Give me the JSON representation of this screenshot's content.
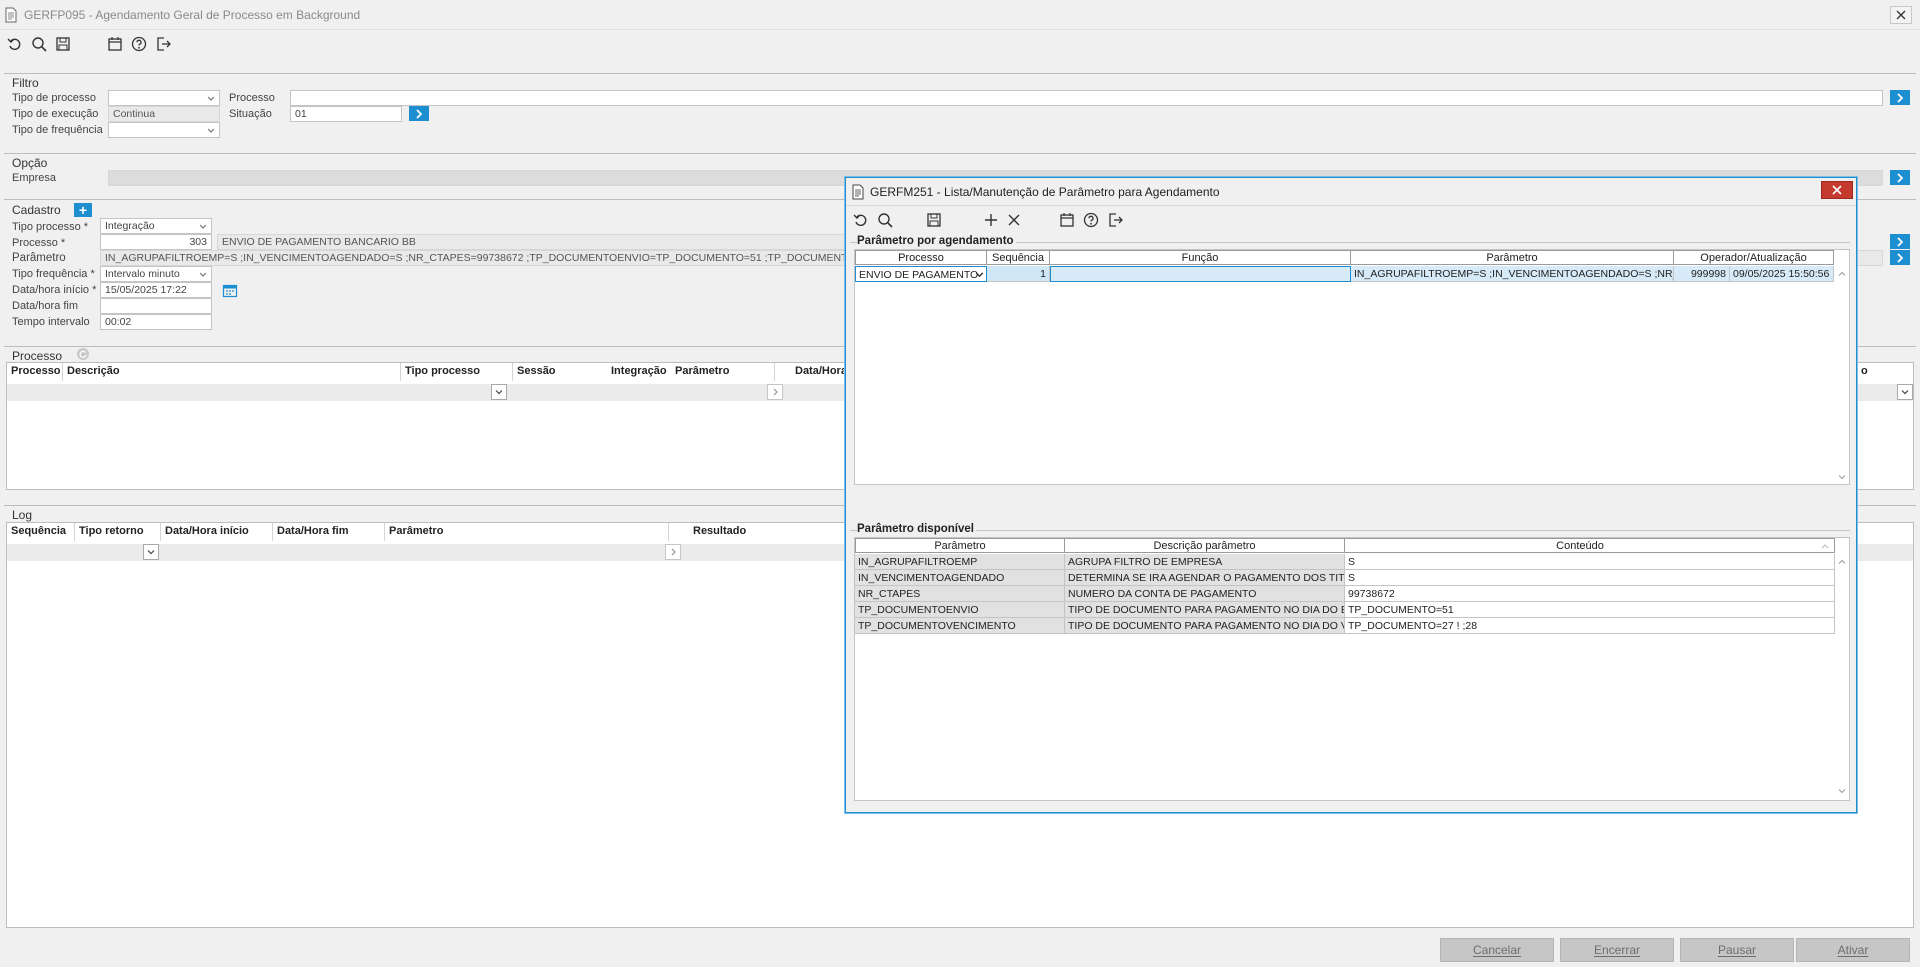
{
  "window": {
    "title": "GERFP095 - Agendamento Geral de Processo em Background"
  },
  "toolbar": {
    "icons": [
      "undo-icon",
      "search-icon",
      "save-icon",
      "calendar-icon",
      "help-icon",
      "exit-icon"
    ]
  },
  "filtro": {
    "title": "Filtro",
    "tipo_processo_label": "Tipo de processo",
    "tipo_execucao_label": "Tipo de execução",
    "tipo_execucao_value": "Continua",
    "tipo_frequencia_label": "Tipo de frequência",
    "processo_label": "Processo",
    "processo_value": "",
    "situacao_label": "Situação",
    "situacao_value": "01"
  },
  "opcao": {
    "title": "Opção",
    "empresa_label": "Empresa"
  },
  "cadastro": {
    "title": "Cadastro",
    "tipo_processo_label": "Tipo processo *",
    "tipo_processo_value": "Integração",
    "processo_label": "Processo *",
    "processo_code": "303",
    "processo_desc": "ENVIO DE PAGAMENTO BANCARIO BB",
    "parametro_label": "Parâmetro",
    "parametro_value": "IN_AGRUPAFILTROEMP=S ;IN_VENCIMENTOAGENDADO=S ;NR_CTAPES=99738672 ;TP_DOCUMENTOENVIO=TP_DOCUMENTO=51 ;TP_DOCUMENTOVEN",
    "tipo_frequencia_label": "Tipo frequência *",
    "tipo_frequencia_value": "Intervalo minuto",
    "data_inicio_label": "Data/hora início *",
    "data_inicio_value": "15/05/2025 17:22",
    "data_fim_label": "Data/hora fim",
    "data_fim_value": "",
    "tempo_intervalo_label": "Tempo intervalo",
    "tempo_intervalo_value": "00:02"
  },
  "processo_grid": {
    "title": "Processo",
    "columns": [
      "Processo",
      "Descrição",
      "Tipo processo",
      "Sessão",
      "Integração",
      "Parâmetro",
      "Data/Hora",
      "o"
    ]
  },
  "log_grid": {
    "title": "Log",
    "columns": [
      "Sequência",
      "Tipo retorno",
      "Data/Hora início",
      "Data/Hora fim",
      "Parâmetro",
      "Resultado"
    ]
  },
  "buttons": {
    "cancelar": "Cancelar",
    "encerrar": "Encerrar",
    "pausar": "Pausar",
    "ativar": "Ativar"
  },
  "modal": {
    "title": "GERFM251 - Lista/Manutenção de Parâmetro para Agendamento",
    "toolbar_icons": [
      "undo-icon",
      "search-icon",
      "save-icon",
      "add-icon",
      "delete-icon",
      "calendar-icon",
      "help-icon",
      "exit-icon"
    ],
    "agendamento": {
      "title": "Parâmetro por agendamento",
      "columns": [
        "Processo",
        "Sequência",
        "Função",
        "Parâmetro",
        "Operador/Atualização"
      ],
      "rows": [
        {
          "processo": "ENVIO DE PAGAMENTO",
          "sequencia": "1",
          "funcao": "",
          "parametro": "IN_AGRUPAFILTROEMP=S ;IN_VENCIMENTOAGENDADO=S ;NR_C",
          "operador": "999998",
          "atualizacao": "09/05/2025 15:50:56"
        }
      ]
    },
    "disponivel": {
      "title": "Parâmetro disponível",
      "columns": [
        "Parâmetro",
        "Descrição parâmetro",
        "Conteúdo"
      ],
      "rows": [
        {
          "parametro": "IN_AGRUPAFILTROEMP",
          "descricao": "AGRUPA FILTRO DE EMPRESA",
          "conteudo": "S"
        },
        {
          "parametro": "IN_VENCIMENTOAGENDADO",
          "descricao": "DETERMINA SE IRA AGENDAR O PAGAMENTO DOS TITUL",
          "conteudo": "S"
        },
        {
          "parametro": "NR_CTAPES",
          "descricao": "NUMERO DA CONTA DE PAGAMENTO",
          "conteudo": "99738672"
        },
        {
          "parametro": "TP_DOCUMENTOENVIO",
          "descricao": "TIPO DE DOCUMENTO PARA PAGAMENTO NO DIA DO ENV",
          "conteudo": "TP_DOCUMENTO=51"
        },
        {
          "parametro": "TP_DOCUMENTOVENCIMENTO",
          "descricao": "TIPO DE DOCUMENTO PARA PAGAMENTO NO DIA DO VE",
          "conteudo": "TP_DOCUMENTO=27 ! ;28"
        }
      ]
    }
  }
}
